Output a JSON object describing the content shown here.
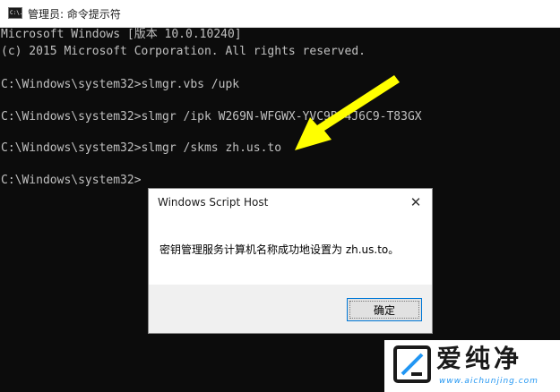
{
  "window": {
    "title": "管理员: 命令提示符",
    "icon": "cmd-icon",
    "icon_text": "C:\\."
  },
  "console": {
    "lines": [
      "Microsoft Windows [版本 10.0.10240]",
      "(c) 2015 Microsoft Corporation. All rights reserved.",
      "C:\\Windows\\system32>slmgr.vbs /upk",
      "C:\\Windows\\system32>slmgr /ipk W269N-WFGWX-YVC9B-4J6C9-T83GX",
      "C:\\Windows\\system32>slmgr /skms zh.us.to",
      "C:\\Windows\\system32>"
    ]
  },
  "annotation": {
    "arrow_color": "#ffff00",
    "arrow_icon": "yellow-arrow-icon"
  },
  "dialog": {
    "title": "Windows Script Host",
    "close_glyph": "✕",
    "message": "密钥管理服务计算机名称成功地设置为 zh.us.to。",
    "ok_label": "确定"
  },
  "watermark": {
    "brand": "爱纯净",
    "url": "www.aichunjing.com",
    "icon": "aichunjing-logo-icon",
    "accent": "#2196f3"
  },
  "colors": {
    "console_bg": "#0c0c0c",
    "console_text": "#c0c0c0",
    "button_border": "#0078d7"
  }
}
